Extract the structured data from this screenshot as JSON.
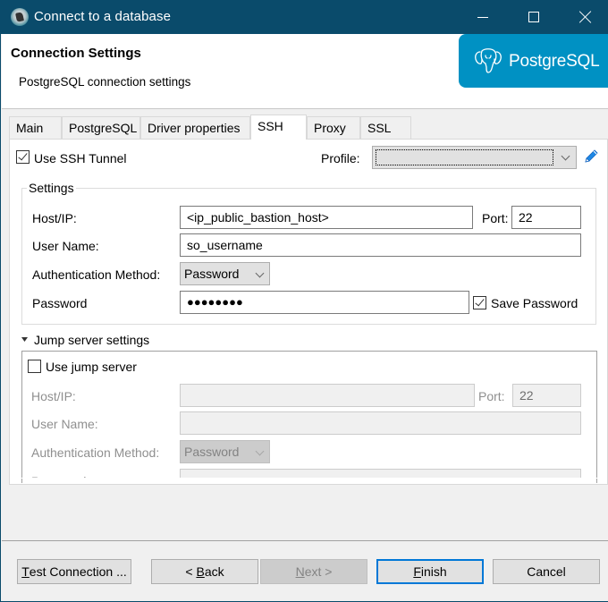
{
  "window": {
    "title": "Connect to a database",
    "controls": {
      "minimize": "minimize",
      "maximize": "maximize",
      "close": "close"
    }
  },
  "header": {
    "title": "Connection Settings",
    "subtitle": "PostgreSQL connection settings",
    "brand": {
      "label": "PostgreSQL",
      "color": "#0091c3"
    }
  },
  "tabs": [
    {
      "label": "Main",
      "active": false
    },
    {
      "label": "PostgreSQL",
      "active": false
    },
    {
      "label": "Driver properties",
      "active": false
    },
    {
      "label": "SSH",
      "active": true
    },
    {
      "label": "Proxy",
      "active": false
    },
    {
      "label": "SSL",
      "active": false
    }
  ],
  "ssh": {
    "use_tunnel": {
      "label": "Use SSH Tunnel",
      "checked": true
    },
    "profile": {
      "label": "Profile:",
      "value": ""
    },
    "settings": {
      "title": "Settings",
      "host_label": "Host/IP:",
      "host_value": "<ip_public_bastion_host>",
      "port_label": "Port:",
      "port_value": "22",
      "user_label": "User Name:",
      "user_value": "so_username",
      "auth_label": "Authentication Method:",
      "auth_value": "Password",
      "password_label": "Password",
      "password_value": "●●●●●●●●",
      "save_password": {
        "label": "Save Password",
        "checked": true
      }
    },
    "jump": {
      "title": "Jump server settings",
      "expanded": true,
      "use_jump": {
        "label": "Use jump server",
        "checked": false
      },
      "host_label": "Host/IP:",
      "host_value": "",
      "port_label": "Port:",
      "port_value": "22",
      "user_label": "User Name:",
      "user_value": "",
      "auth_label": "Authentication Method:",
      "auth_value": "Password",
      "password_label": "Password",
      "password_value": ""
    }
  },
  "footer": {
    "test_connection": {
      "label_pre": "",
      "mnemonic": "T",
      "label_post": "est Connection ..."
    },
    "back": {
      "label_pre": "< ",
      "mnemonic": "B",
      "label_post": "ack"
    },
    "next": {
      "label_pre": "",
      "mnemonic": "N",
      "label_post": "ext >",
      "enabled": false
    },
    "finish": {
      "label_pre": "",
      "mnemonic": "F",
      "label_post": "inish",
      "default": true
    },
    "cancel": {
      "label": "Cancel"
    }
  },
  "colors": {
    "titlebar": "#0a4b6b",
    "focus_accent": "#0078d7",
    "pencil": "#1e88e5"
  }
}
